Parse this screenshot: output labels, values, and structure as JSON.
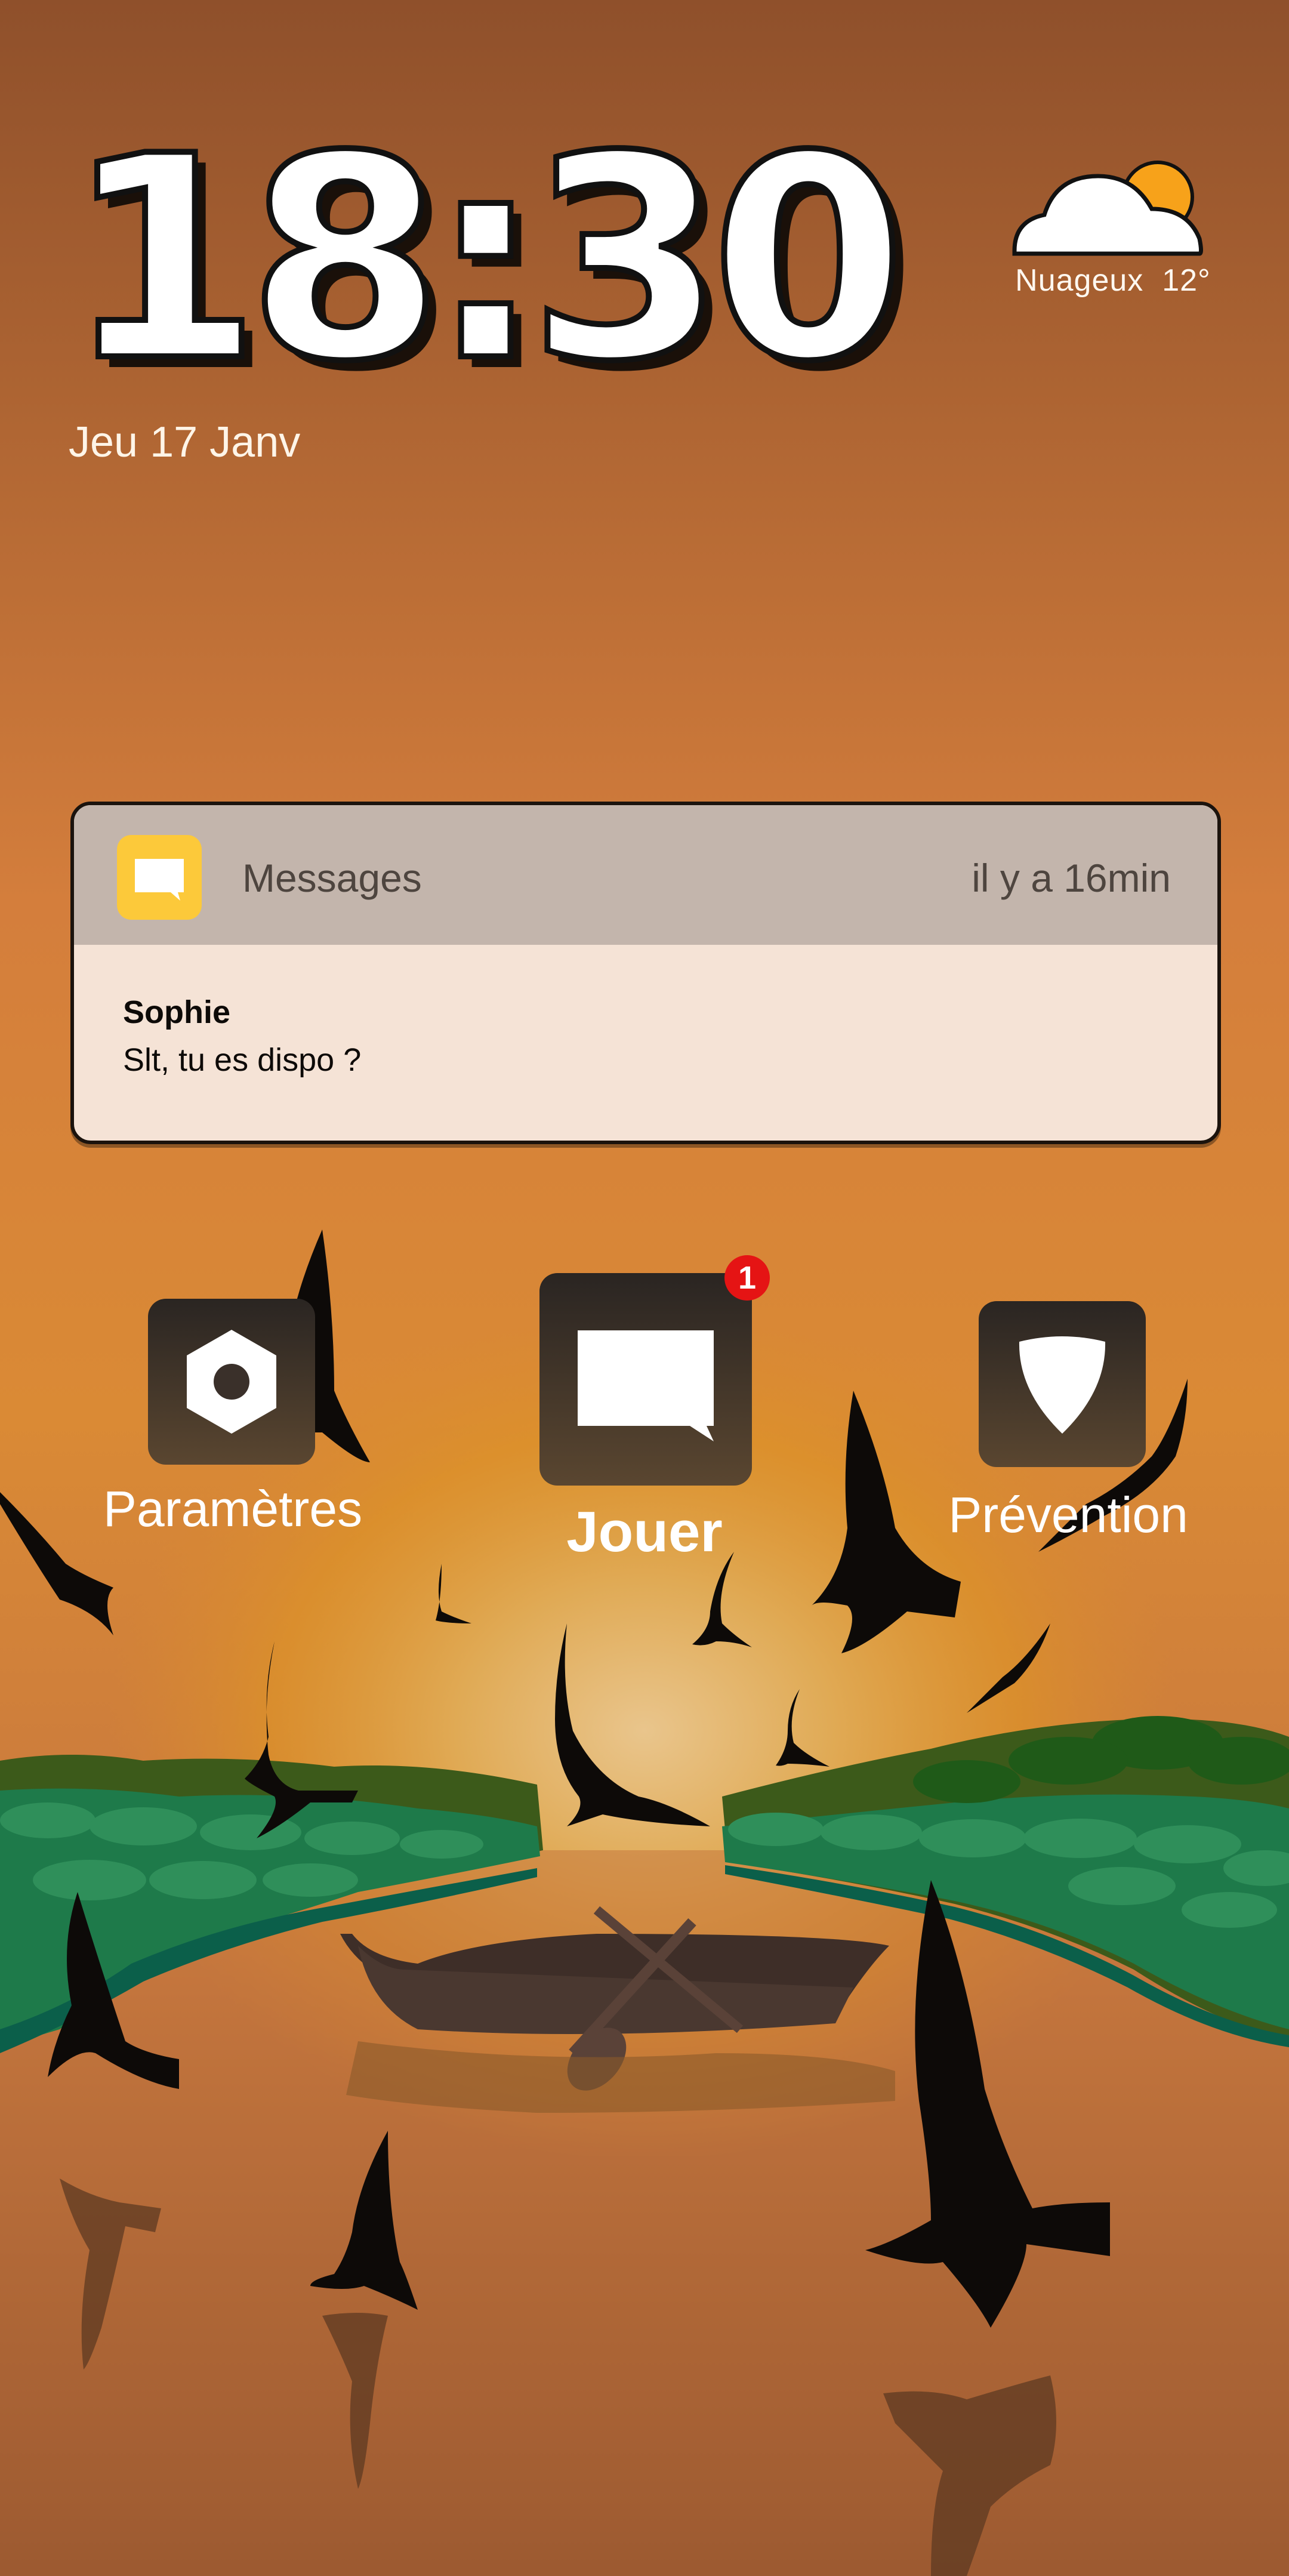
{
  "lockscreen": {
    "time": "18:30",
    "date": "Jeu 17 Janv",
    "weather": {
      "condition": "Nuageux",
      "temperature": "12°",
      "icon": "partly-cloudy-icon"
    }
  },
  "notification": {
    "app_name": "Messages",
    "time_ago": "il y a 16min",
    "sender": "Sophie",
    "message": "Slt, tu es dispo ?",
    "icon": "message-bubble-icon",
    "icon_color": "#FCC93A"
  },
  "apps": [
    {
      "label": "Paramètres",
      "icon": "settings-hexagon-icon"
    },
    {
      "label": "Jouer",
      "icon": "chat-bubble-icon",
      "badge": "1"
    },
    {
      "label": "Prévention",
      "icon": "shield-icon"
    }
  ],
  "colors": {
    "sky_top": "#8f502b",
    "sky_mid": "#d47d3c",
    "sun_glow": "#e0a040",
    "badge": "#E51414"
  }
}
